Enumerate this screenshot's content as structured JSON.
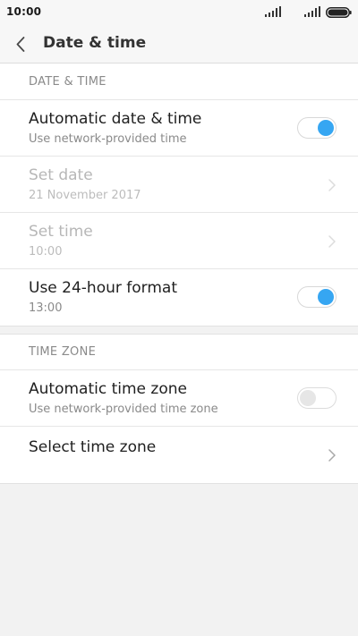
{
  "status_bar": {
    "time": "10:00"
  },
  "header": {
    "title": "Date & time",
    "back_icon": "chevron-left-icon"
  },
  "date_time_section": {
    "header": "DATE & TIME",
    "automatic_date_time": {
      "title": "Automatic date & time",
      "subtitle": "Use network-provided time",
      "enabled": true
    },
    "set_date": {
      "title": "Set date",
      "subtitle": "21 November 2017"
    },
    "set_time": {
      "title": "Set time",
      "subtitle": "10:00"
    },
    "use_24_hour": {
      "title": "Use 24-hour format",
      "subtitle": "13:00",
      "enabled": true
    }
  },
  "time_zone_section": {
    "header": "TIME ZONE",
    "automatic_time_zone": {
      "title": "Automatic time zone",
      "subtitle": "Use network-provided time zone",
      "enabled": false
    },
    "select_time_zone": {
      "title": "Select time zone"
    }
  },
  "colors": {
    "accent": "#36a6f2",
    "background": "#f2f2f2",
    "surface": "#ffffff"
  }
}
